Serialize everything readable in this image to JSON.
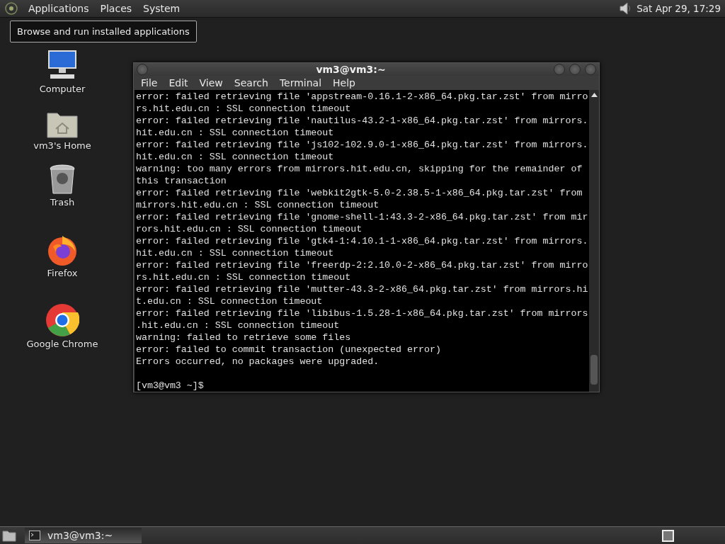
{
  "top_panel": {
    "menus": [
      "Applications",
      "Places",
      "System"
    ],
    "clock": "Sat Apr 29, 17:29"
  },
  "tooltip": "Browse and run installed applications",
  "desktop_icons": [
    {
      "kind": "computer",
      "label": "Computer"
    },
    {
      "kind": "home",
      "label": "vm3's Home"
    },
    {
      "kind": "trash",
      "label": "Trash"
    },
    {
      "kind": "firefox",
      "label": "Firefox"
    },
    {
      "kind": "chrome",
      "label": "Google Chrome"
    }
  ],
  "terminal": {
    "title": "vm3@vm3:~",
    "menu": [
      "File",
      "Edit",
      "View",
      "Search",
      "Terminal",
      "Help"
    ],
    "lines": [
      "error: failed retrieving file 'appstream-0.16.1-2-x86_64.pkg.tar.zst' from mirro",
      "rs.hit.edu.cn : SSL connection timeout",
      "error: failed retrieving file 'nautilus-43.2-1-x86_64.pkg.tar.zst' from mirrors.",
      "hit.edu.cn : SSL connection timeout",
      "error: failed retrieving file 'js102-102.9.0-1-x86_64.pkg.tar.zst' from mirrors.",
      "hit.edu.cn : SSL connection timeout",
      "warning: too many errors from mirrors.hit.edu.cn, skipping for the remainder of",
      "this transaction",
      "error: failed retrieving file 'webkit2gtk-5.0-2.38.5-1-x86_64.pkg.tar.zst' from",
      "mirrors.hit.edu.cn : SSL connection timeout",
      "error: failed retrieving file 'gnome-shell-1:43.3-2-x86_64.pkg.tar.zst' from mir",
      "rors.hit.edu.cn : SSL connection timeout",
      "error: failed retrieving file 'gtk4-1:4.10.1-1-x86_64.pkg.tar.zst' from mirrors.",
      "hit.edu.cn : SSL connection timeout",
      "error: failed retrieving file 'freerdp-2:2.10.0-2-x86_64.pkg.tar.zst' from mirro",
      "rs.hit.edu.cn : SSL connection timeout",
      "error: failed retrieving file 'mutter-43.3-2-x86_64.pkg.tar.zst' from mirrors.hi",
      "t.edu.cn : SSL connection timeout",
      "error: failed retrieving file 'libibus-1.5.28-1-x86_64.pkg.tar.zst' from mirrors",
      ".hit.edu.cn : SSL connection timeout",
      "warning: failed to retrieve some files",
      "error: failed to commit transaction (unexpected error)",
      "Errors occurred, no packages were upgraded."
    ],
    "prompt": "[vm3@vm3 ~]$"
  },
  "taskbar": {
    "items": [
      {
        "label": "vm3@vm3:~"
      }
    ]
  }
}
